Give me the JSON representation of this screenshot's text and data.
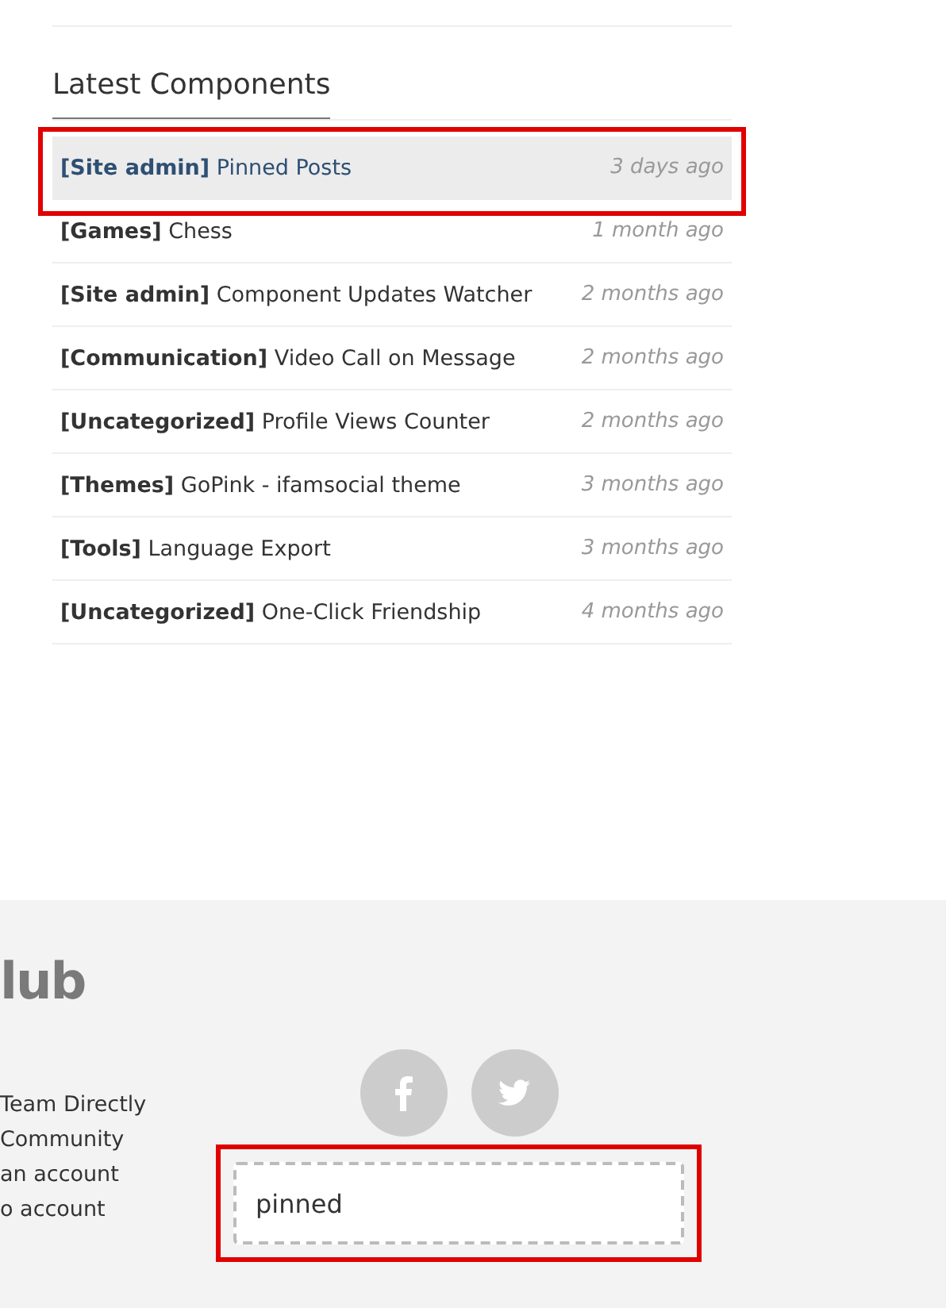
{
  "latest_components": {
    "title": "Latest Components",
    "rows": [
      {
        "category": "[Site admin]",
        "name": "Pinned Posts",
        "time": "3 days ago",
        "highlighted": true
      },
      {
        "category": "[Games]",
        "name": "Chess",
        "time": "1 month ago",
        "highlighted": false
      },
      {
        "category": "[Site admin]",
        "name": "Component Updates Watcher",
        "time": "2 months ago",
        "highlighted": false
      },
      {
        "category": "[Communication]",
        "name": "Video Call on Message",
        "time": "2 months ago",
        "highlighted": false
      },
      {
        "category": "[Uncategorized]",
        "name": "Profile Views Counter",
        "time": "2 months ago",
        "highlighted": false
      },
      {
        "category": "[Themes]",
        "name": "GoPink - ifamsocial theme",
        "time": "3 months ago",
        "highlighted": false
      },
      {
        "category": "[Tools]",
        "name": "Language Export",
        "time": "3 months ago",
        "highlighted": false
      },
      {
        "category": "[Uncategorized]",
        "name": "One-Click Friendship",
        "time": "4 months ago",
        "highlighted": false
      }
    ]
  },
  "footer": {
    "logo": "lub",
    "links": [
      "Team Directly",
      "Community",
      "an account",
      "o account"
    ],
    "social": [
      {
        "kind": "facebook"
      },
      {
        "kind": "twitter"
      }
    ],
    "search": {
      "value": "pinned",
      "highlighted": true
    }
  }
}
